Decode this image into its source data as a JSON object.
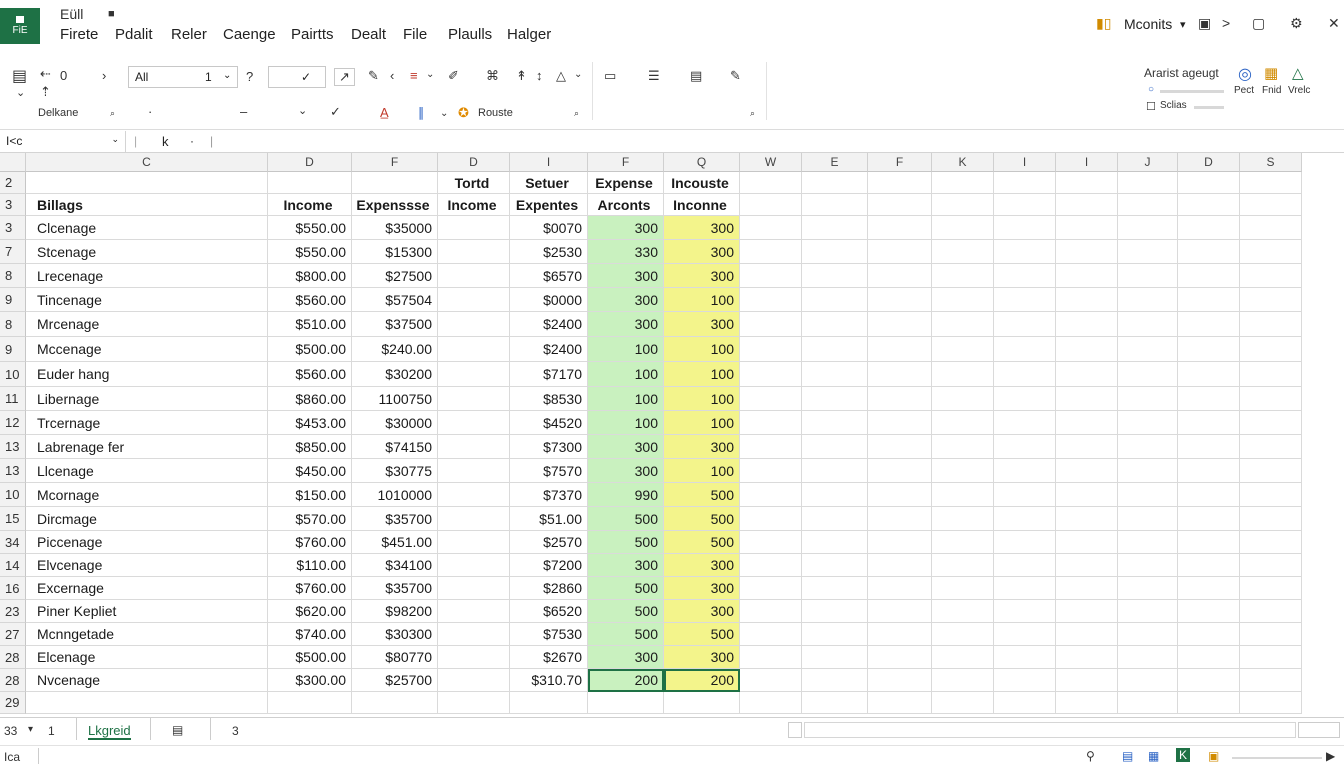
{
  "app": {
    "icon_label": "FiE",
    "top_menu": [
      "Eüll"
    ]
  },
  "menu_tabs": [
    "Firete",
    "Pdalit",
    "Reler",
    "Caenge",
    "Pairtts",
    "Dealt",
    "File",
    "Plaulls",
    "Halger"
  ],
  "header_right": {
    "title": "Mconits",
    "title_chevron": "▾",
    "nav_next": ">",
    "close": "✕"
  },
  "ribbon": {
    "undo_value": "0",
    "font_name": "All",
    "font_size": "1",
    "label_delete": "Delkane",
    "label_route": "Rouste",
    "right_title": "Ararist ageugt",
    "right_check": "Sclias",
    "right_buttons": [
      "Pect",
      "Fnid",
      "Vrelc"
    ]
  },
  "formula_bar": {
    "name_box": "I<c",
    "cursor": "k"
  },
  "columns": [
    "",
    "C",
    "D",
    "F",
    "D",
    "I",
    "F",
    "Q",
    "W",
    "E",
    "F",
    "K",
    "I",
    "I",
    "J",
    "D",
    "S"
  ],
  "header_rows": [
    {
      "row": "2",
      "cells": [
        "",
        "",
        "",
        "Tortd",
        "Setuer",
        "Expense",
        "Incouste"
      ]
    },
    {
      "row": "3",
      "cells": [
        "Billags",
        "Income",
        "Expenssse",
        "Income",
        "Expentes",
        "Arconts",
        "Inconne"
      ]
    }
  ],
  "rows": [
    {
      "row": "3",
      "name": "Clcenage",
      "income": "$550.00",
      "expense": "$35000",
      "setuer": "$0070",
      "g": "300",
      "y": "300"
    },
    {
      "row": "7",
      "name": "Stcenage",
      "income": "$550.00",
      "expense": "$15300",
      "setuer": "$2530",
      "g": "330",
      "y": "300"
    },
    {
      "row": "8",
      "name": "Lrecenage",
      "income": "$800.00",
      "expense": "$27500",
      "setuer": "$6570",
      "g": "300",
      "y": "300"
    },
    {
      "row": "9",
      "name": "Tincenage",
      "income": "$560.00",
      "expense": "$57504",
      "setuer": "$0000",
      "g": "300",
      "y": "100"
    },
    {
      "row": "8",
      "name": "Mrcenage",
      "income": "$510.00",
      "expense": "$37500",
      "setuer": "$2400",
      "g": "300",
      "y": "300"
    },
    {
      "row": "9",
      "name": "Mccenage",
      "income": "$500.00",
      "expense": "$240.00",
      "setuer": "$2400",
      "g": "100",
      "y": "100"
    },
    {
      "row": "10",
      "name": "Euder hang",
      "income": "$560.00",
      "expense": "$30200",
      "setuer": "$7170",
      "g": "100",
      "y": "100"
    },
    {
      "row": "11",
      "name": "Libernage",
      "income": "$860.00",
      "expense": "1100750",
      "setuer": "$8530",
      "g": "100",
      "y": "100"
    },
    {
      "row": "12",
      "name": "Trcernage",
      "income": "$453.00",
      "expense": "$30000",
      "setuer": "$4520",
      "g": "100",
      "y": "100"
    },
    {
      "row": "13",
      "name": "Labrenage fer",
      "income": "$850.00",
      "expense": "$74150",
      "setuer": "$7300",
      "g": "300",
      "y": "300"
    },
    {
      "row": "13",
      "name": "Llcenage",
      "income": "$450.00",
      "expense": "$30775",
      "setuer": "$7570",
      "g": "300",
      "y": "100"
    },
    {
      "row": "10",
      "name": "Mcornage",
      "income": "$150.00",
      "expense": "1010000",
      "setuer": "$7370",
      "g": "990",
      "y": "500"
    },
    {
      "row": "15",
      "name": "Dircmage",
      "income": "$570.00",
      "expense": "$35700",
      "setuer": "$51.00",
      "g": "500",
      "y": "500"
    },
    {
      "row": "34",
      "name": "Piccenage",
      "income": "$760.00",
      "expense": "$451.00",
      "setuer": "$2570",
      "g": "500",
      "y": "500"
    },
    {
      "row": "14",
      "name": "Elvcenage",
      "income": "$110.00",
      "expense": "$34100",
      "setuer": "$7200",
      "g": "300",
      "y": "300"
    },
    {
      "row": "16",
      "name": "Excernage",
      "income": "$760.00",
      "expense": "$35700",
      "setuer": "$2860",
      "g": "500",
      "y": "300"
    },
    {
      "row": "23",
      "name": "Piner Kepliet",
      "income": "$620.00",
      "expense": "$98200",
      "setuer": "$6520",
      "g": "500",
      "y": "300"
    },
    {
      "row": "27",
      "name": "Mcnngetade",
      "income": "$740.00",
      "expense": "$30300",
      "setuer": "$7530",
      "g": "500",
      "y": "500"
    },
    {
      "row": "28",
      "name": "Elcenage",
      "income": "$500.00",
      "expense": "$80770",
      "setuer": "$2670",
      "g": "300",
      "y": "300"
    },
    {
      "row": "28",
      "name": "Nvcenage",
      "income": "$300.00",
      "expense": "$25700",
      "setuer": "$310.70",
      "g": "200",
      "y": "200"
    }
  ],
  "last_row_label": "29",
  "sheet_tabs": {
    "left": "33",
    "chev": "▾",
    "num": "1",
    "active": "Lkgreid",
    "after": "3"
  },
  "status": {
    "left": "Ica"
  },
  "colors": {
    "accent": "#1e7145",
    "green_fill": "#c9f1bf",
    "yellow_fill": "#f3f48b"
  }
}
